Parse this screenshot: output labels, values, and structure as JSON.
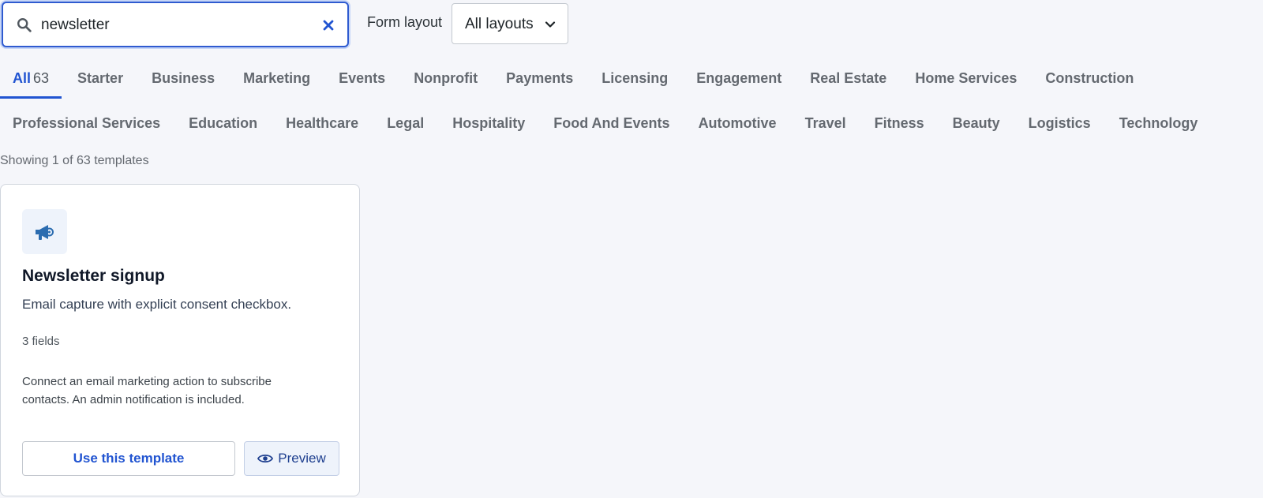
{
  "search": {
    "value": "newsletter",
    "icon": "search-icon",
    "clear_icon": "close-icon"
  },
  "layout_filter": {
    "label": "Form layout",
    "selected": "All layouts"
  },
  "tabs_row1": [
    {
      "label": "All",
      "count": "63",
      "active": true
    },
    {
      "label": "Starter"
    },
    {
      "label": "Business"
    },
    {
      "label": "Marketing"
    },
    {
      "label": "Events"
    },
    {
      "label": "Nonprofit"
    },
    {
      "label": "Payments"
    },
    {
      "label": "Licensing"
    },
    {
      "label": "Engagement"
    },
    {
      "label": "Real Estate"
    },
    {
      "label": "Home Services"
    },
    {
      "label": "Construction"
    }
  ],
  "tabs_row2": [
    {
      "label": "Professional Services"
    },
    {
      "label": "Education"
    },
    {
      "label": "Healthcare"
    },
    {
      "label": "Legal"
    },
    {
      "label": "Hospitality"
    },
    {
      "label": "Food And Events"
    },
    {
      "label": "Automotive"
    },
    {
      "label": "Travel"
    },
    {
      "label": "Fitness"
    },
    {
      "label": "Beauty"
    },
    {
      "label": "Logistics"
    },
    {
      "label": "Technology"
    }
  ],
  "results": {
    "summary": "Showing 1 of 63 templates"
  },
  "card": {
    "icon": "megaphone-icon",
    "title": "Newsletter signup",
    "description": "Email capture with explicit consent checkbox.",
    "fields": "3 fields",
    "note": "Connect an email marketing action to subscribe contacts. An admin notification is included.",
    "use_label": "Use this template",
    "preview_label": "Preview"
  },
  "colors": {
    "accent": "#2154d1",
    "background": "#f5f6fa",
    "icon": "#2b6cb0"
  }
}
